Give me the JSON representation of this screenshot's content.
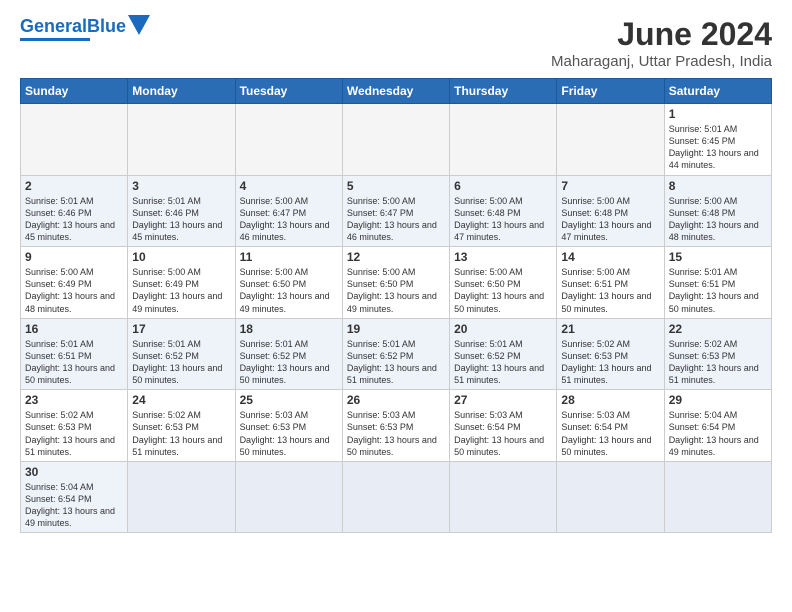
{
  "header": {
    "logo_line1": "General",
    "logo_line2": "Blue",
    "title": "June 2024",
    "subtitle": "Maharaganj, Uttar Pradesh, India"
  },
  "weekdays": [
    "Sunday",
    "Monday",
    "Tuesday",
    "Wednesday",
    "Thursday",
    "Friday",
    "Saturday"
  ],
  "weeks": [
    [
      {
        "day": null,
        "info": null
      },
      {
        "day": null,
        "info": null
      },
      {
        "day": null,
        "info": null
      },
      {
        "day": null,
        "info": null
      },
      {
        "day": null,
        "info": null
      },
      {
        "day": null,
        "info": null
      },
      {
        "day": "1",
        "info": "Sunrise: 5:01 AM\nSunset: 6:45 PM\nDaylight: 13 hours\nand 44 minutes."
      }
    ],
    [
      {
        "day": "2",
        "info": "Sunrise: 5:01 AM\nSunset: 6:46 PM\nDaylight: 13 hours\nand 45 minutes."
      },
      {
        "day": "3",
        "info": "Sunrise: 5:01 AM\nSunset: 6:46 PM\nDaylight: 13 hours\nand 45 minutes."
      },
      {
        "day": "4",
        "info": "Sunrise: 5:00 AM\nSunset: 6:47 PM\nDaylight: 13 hours\nand 46 minutes."
      },
      {
        "day": "5",
        "info": "Sunrise: 5:00 AM\nSunset: 6:47 PM\nDaylight: 13 hours\nand 46 minutes."
      },
      {
        "day": "6",
        "info": "Sunrise: 5:00 AM\nSunset: 6:48 PM\nDaylight: 13 hours\nand 47 minutes."
      },
      {
        "day": "7",
        "info": "Sunrise: 5:00 AM\nSunset: 6:48 PM\nDaylight: 13 hours\nand 47 minutes."
      },
      {
        "day": "8",
        "info": "Sunrise: 5:00 AM\nSunset: 6:48 PM\nDaylight: 13 hours\nand 48 minutes."
      }
    ],
    [
      {
        "day": "9",
        "info": "Sunrise: 5:00 AM\nSunset: 6:49 PM\nDaylight: 13 hours\nand 48 minutes."
      },
      {
        "day": "10",
        "info": "Sunrise: 5:00 AM\nSunset: 6:49 PM\nDaylight: 13 hours\nand 49 minutes."
      },
      {
        "day": "11",
        "info": "Sunrise: 5:00 AM\nSunset: 6:50 PM\nDaylight: 13 hours\nand 49 minutes."
      },
      {
        "day": "12",
        "info": "Sunrise: 5:00 AM\nSunset: 6:50 PM\nDaylight: 13 hours\nand 49 minutes."
      },
      {
        "day": "13",
        "info": "Sunrise: 5:00 AM\nSunset: 6:50 PM\nDaylight: 13 hours\nand 50 minutes."
      },
      {
        "day": "14",
        "info": "Sunrise: 5:00 AM\nSunset: 6:51 PM\nDaylight: 13 hours\nand 50 minutes."
      },
      {
        "day": "15",
        "info": "Sunrise: 5:01 AM\nSunset: 6:51 PM\nDaylight: 13 hours\nand 50 minutes."
      }
    ],
    [
      {
        "day": "16",
        "info": "Sunrise: 5:01 AM\nSunset: 6:51 PM\nDaylight: 13 hours\nand 50 minutes."
      },
      {
        "day": "17",
        "info": "Sunrise: 5:01 AM\nSunset: 6:52 PM\nDaylight: 13 hours\nand 50 minutes."
      },
      {
        "day": "18",
        "info": "Sunrise: 5:01 AM\nSunset: 6:52 PM\nDaylight: 13 hours\nand 50 minutes."
      },
      {
        "day": "19",
        "info": "Sunrise: 5:01 AM\nSunset: 6:52 PM\nDaylight: 13 hours\nand 51 minutes."
      },
      {
        "day": "20",
        "info": "Sunrise: 5:01 AM\nSunset: 6:52 PM\nDaylight: 13 hours\nand 51 minutes."
      },
      {
        "day": "21",
        "info": "Sunrise: 5:02 AM\nSunset: 6:53 PM\nDaylight: 13 hours\nand 51 minutes."
      },
      {
        "day": "22",
        "info": "Sunrise: 5:02 AM\nSunset: 6:53 PM\nDaylight: 13 hours\nand 51 minutes."
      }
    ],
    [
      {
        "day": "23",
        "info": "Sunrise: 5:02 AM\nSunset: 6:53 PM\nDaylight: 13 hours\nand 51 minutes."
      },
      {
        "day": "24",
        "info": "Sunrise: 5:02 AM\nSunset: 6:53 PM\nDaylight: 13 hours\nand 51 minutes."
      },
      {
        "day": "25",
        "info": "Sunrise: 5:03 AM\nSunset: 6:53 PM\nDaylight: 13 hours\nand 50 minutes."
      },
      {
        "day": "26",
        "info": "Sunrise: 5:03 AM\nSunset: 6:53 PM\nDaylight: 13 hours\nand 50 minutes."
      },
      {
        "day": "27",
        "info": "Sunrise: 5:03 AM\nSunset: 6:54 PM\nDaylight: 13 hours\nand 50 minutes."
      },
      {
        "day": "28",
        "info": "Sunrise: 5:03 AM\nSunset: 6:54 PM\nDaylight: 13 hours\nand 50 minutes."
      },
      {
        "day": "29",
        "info": "Sunrise: 5:04 AM\nSunset: 6:54 PM\nDaylight: 13 hours\nand 49 minutes."
      }
    ],
    [
      {
        "day": "30",
        "info": "Sunrise: 5:04 AM\nSunset: 6:54 PM\nDaylight: 13 hours\nand 49 minutes."
      },
      {
        "day": null,
        "info": null
      },
      {
        "day": null,
        "info": null
      },
      {
        "day": null,
        "info": null
      },
      {
        "day": null,
        "info": null
      },
      {
        "day": null,
        "info": null
      },
      {
        "day": null,
        "info": null
      }
    ]
  ]
}
